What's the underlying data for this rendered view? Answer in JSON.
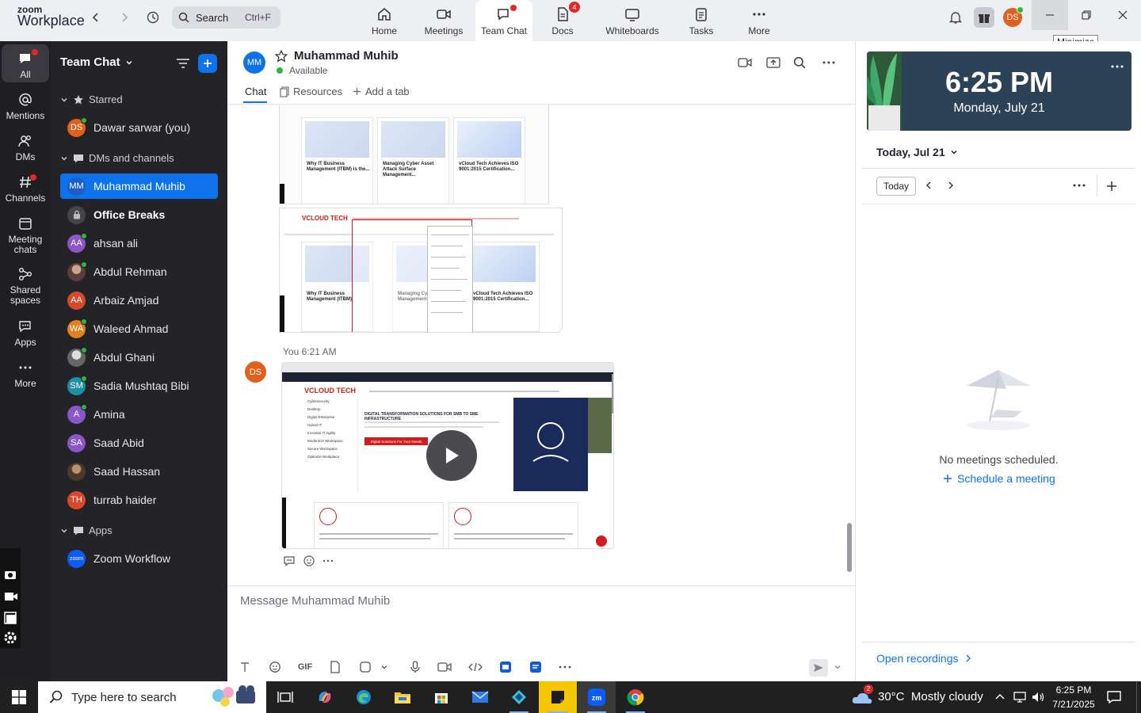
{
  "app": {
    "logo_line1": "zoom",
    "logo_line2": "Workplace",
    "search_placeholder": "Search",
    "search_shortcut": "Ctrl+F",
    "tabs": [
      {
        "label": "Home",
        "icon": "home-icon"
      },
      {
        "label": "Meetings",
        "icon": "video-camera-icon"
      },
      {
        "label": "Team Chat",
        "icon": "chat-bubble-icon",
        "active": true
      },
      {
        "label": "Docs",
        "icon": "docs-icon",
        "badge": "4"
      },
      {
        "label": "Whiteboards",
        "icon": "whiteboard-icon"
      },
      {
        "label": "Tasks",
        "icon": "tasks-icon"
      },
      {
        "label": "More",
        "icon": "more-dots-icon"
      }
    ],
    "user_initials": "DS",
    "minimize_tooltip": "Minimize"
  },
  "rail": {
    "items": [
      {
        "label": "All",
        "icon": "chat-icon"
      },
      {
        "label": "Mentions",
        "icon": "at-icon"
      },
      {
        "label": "DMs",
        "icon": "people-icon"
      },
      {
        "label": "Channels",
        "icon": "hash-icon"
      },
      {
        "label": "Meeting chats",
        "icon": "calendar-icon"
      },
      {
        "label": "Shared spaces",
        "icon": "shared-icon"
      },
      {
        "label": "Apps",
        "icon": "apps-icon"
      },
      {
        "label": "More",
        "icon": "more-dots-icon"
      }
    ]
  },
  "sidebar": {
    "title": "Team Chat",
    "starred_label": "Starred",
    "starred": [
      {
        "initials": "DS",
        "name": "Dawar sarwar (you)",
        "color": "#e0601e"
      }
    ],
    "dms_label": "DMs and channels",
    "dms": [
      {
        "initials": "MM",
        "name": "Muhammad Muhib",
        "color": "#0e72ed",
        "selected": true
      },
      {
        "initials": "",
        "name": "Office Breaks",
        "color": "#444449",
        "bold": true
      },
      {
        "initials": "AA",
        "name": "ahsan ali",
        "color": "#8b56c8"
      },
      {
        "initials": "",
        "name": "Abdul Rehman",
        "color": "#6b4a4a"
      },
      {
        "initials": "AA",
        "name": "Arbaiz Amjad",
        "color": "#d9482b"
      },
      {
        "initials": "WA",
        "name": "Waleed Ahmad",
        "color": "#e0801e"
      },
      {
        "initials": "",
        "name": "Abdul Ghani",
        "color": "#777"
      },
      {
        "initials": "SM",
        "name": "Sadia Mushtaq Bibi",
        "color": "#1f8fa6"
      },
      {
        "initials": "A",
        "name": "Amina",
        "color": "#8b56c8"
      },
      {
        "initials": "SA",
        "name": "Saad Abid",
        "color": "#8b56c8"
      },
      {
        "initials": "",
        "name": "Saad Hassan",
        "color": "#5a4a3a"
      },
      {
        "initials": "TH",
        "name": "turrab haider",
        "color": "#d9482b"
      }
    ],
    "apps_label": "Apps",
    "apps": [
      {
        "initials": "zoom",
        "name": "Zoom Workflow",
        "color": "#0b5cff"
      }
    ]
  },
  "chat": {
    "contact_initials": "MM",
    "contact_name": "Muhammad Muhib",
    "contact_status": "Available",
    "tabs": [
      "Chat",
      "Resources",
      "Add a tab"
    ],
    "shot_cards": [
      "Why IT Business Management (ITBM) is the...",
      "Managing Cyber Asset Attack Surface Management...",
      "vCloud Tech Achieves ISO 9001:2015 Certification..."
    ],
    "shot2_cards": [
      "Why IT Business Management (ITBM)",
      "Managing Cyber Surface Management",
      "vCloud Tech Achieves ISO 9001:2015 Certification..."
    ],
    "site_logo": "VCLOUD TECH",
    "video_headline": "DIGITAL TRANSFORMATION SOLUTIONS FOR SMB TO SME INFRASTRUCTURE",
    "video_cta": "Digital Solutions For Your Needs",
    "video_menu": [
      "Cybersecurity",
      "Desktop",
      "Digital Enterprise",
      "Hybrid IT",
      "Increase IT Agility",
      "Modernize Workspace",
      "Secure Workspace",
      "Optimize Workplace"
    ],
    "msg_sender": "You",
    "msg_time": "6:21 AM",
    "msg_sender_initials": "DS",
    "composer_placeholder": "Message Muhammad Muhib",
    "gif_label": "GIF"
  },
  "calendar": {
    "time": "6:25 PM",
    "date": "Monday, July 21",
    "day_label": "Today, Jul 21",
    "today_button": "Today",
    "empty_text": "No meetings scheduled.",
    "schedule_link": "Schedule a meeting",
    "recordings_link": "Open recordings"
  },
  "taskbar": {
    "search_placeholder": "Type here to search",
    "weather": "30°C  Mostly cloudy",
    "weather_badge": "2",
    "time": "6:25 PM",
    "date": "7/21/2025"
  },
  "colors": {
    "accent": "#0e72ed",
    "sidebar_bg": "#232328",
    "rail_bg": "#1f1f23",
    "clock_bg": "#2c4257",
    "available": "#2db83d"
  }
}
